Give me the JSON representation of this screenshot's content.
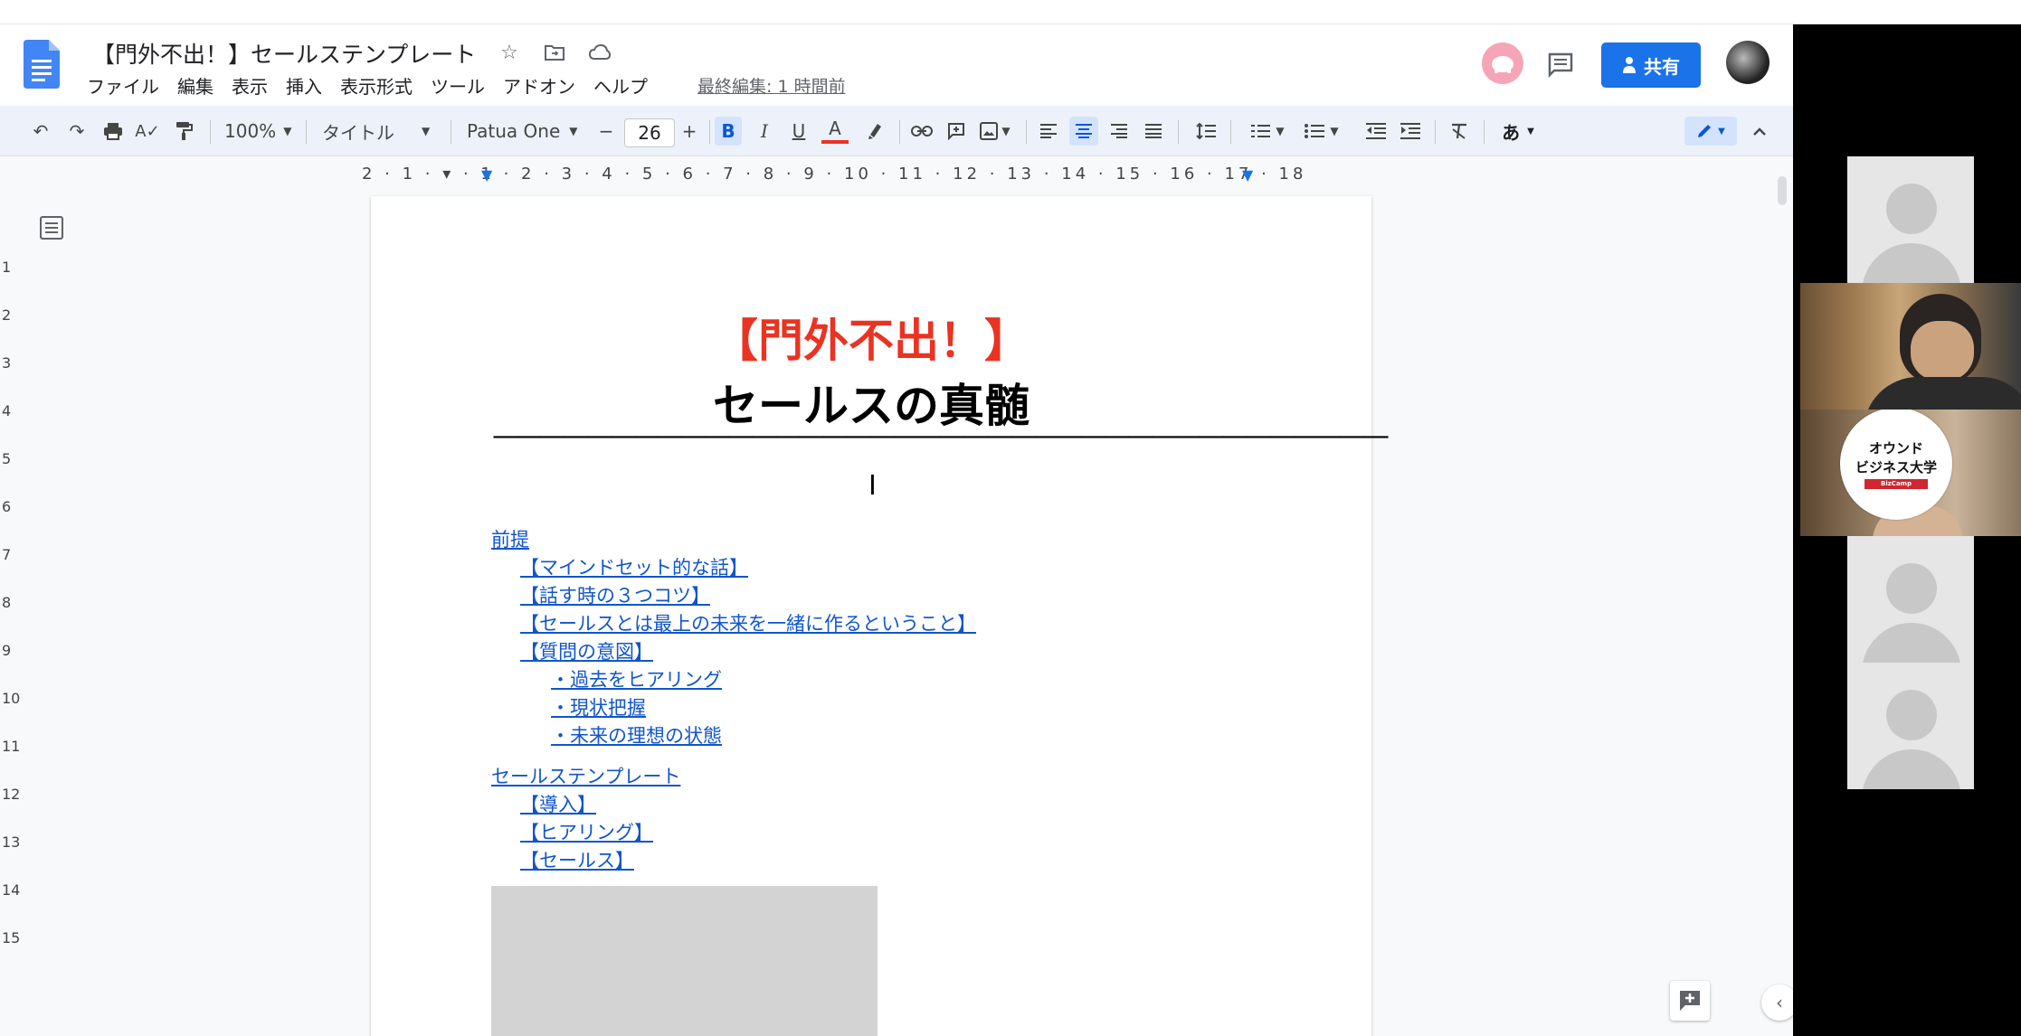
{
  "document": {
    "title": "【門外不出！】セールステンプレート",
    "last_edit": "最終編集: 1 時間前",
    "share_label": "共有"
  },
  "menu": [
    "ファイル",
    "編集",
    "表示",
    "挿入",
    "表示形式",
    "ツール",
    "アドオン",
    "ヘルプ"
  ],
  "toolbar": {
    "zoom": "100%",
    "style": "タイトル",
    "font": "Patua One",
    "font_size": "26",
    "minus": "−",
    "plus": "+",
    "bold": "B",
    "italic": "I",
    "underline": "U",
    "text_color": "A",
    "input_tools": "あ"
  },
  "ruler": {
    "horizontal": "2 · 1 · ▾ · 1 · 2 · 3 · 4 · 5 · 6 · 7 · 8 · 9 · 10 · 11 · 12 · 13 · 14 · 15 · 16 · 17 · 18",
    "vertical": [
      "1",
      "2",
      "3",
      "4",
      "5",
      "6",
      "7",
      "8",
      "9",
      "10",
      "11",
      "12",
      "13",
      "14",
      "15"
    ]
  },
  "body": {
    "heading_red": "【門外不出！】",
    "heading_black": "セールスの真髄",
    "divider": "——————————————————————————————————————",
    "toc": {
      "premise": "前提",
      "mindset": "【マインドセット的な話】",
      "three_tips": "【話す時の３つコツ】",
      "sales_is": "【セールスとは最上の未来を一緒に作るということ】",
      "question_intent": "【質問の意図】",
      "past_hearing": "・過去をヒアリング",
      "current_state": "・現状把握",
      "future_ideal": "・未来の理想の状態",
      "sales_template": "セールステンプレート",
      "intro": "【導入】",
      "hearing": "【ヒアリング】",
      "sales": "【セールス】"
    }
  },
  "video": {
    "logo_line1": "オウンド",
    "logo_line2": "ビジネス大学",
    "logo_badge": "BizCamp"
  },
  "colors": {
    "accent": "#1a73e8",
    "heading_red": "#ea3323",
    "link": "#1155cc"
  }
}
